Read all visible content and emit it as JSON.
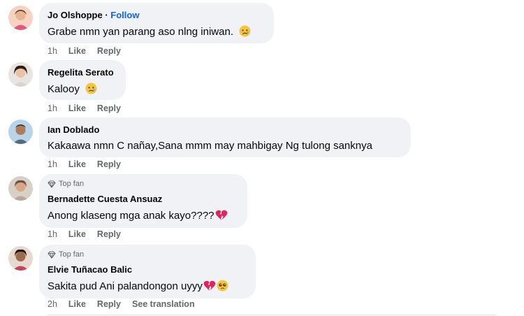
{
  "comments": [
    {
      "author": "Jo Olshoppe",
      "separator": " · ",
      "follow_label": "Follow",
      "text": "Grabe nmn yan parang aso nlng iniwan.",
      "emoji": "sad-face-icon",
      "time": "1h",
      "like_label": "Like",
      "reply_label": "Reply"
    },
    {
      "author": "Regelita Serato",
      "text": "Kalooy",
      "emoji": "sad-face-icon",
      "time": "1h",
      "like_label": "Like",
      "reply_label": "Reply"
    },
    {
      "author": "Ian Doblado",
      "text": "Kakaawa nmn C nañay,Sana mmm may mahbigay Ng tulong sanknya",
      "time": "1h",
      "like_label": "Like",
      "reply_label": "Reply"
    },
    {
      "badge": "Top fan",
      "author": "Bernadette Cuesta Ansuaz",
      "text": "Anong klaseng mga anak kayo????",
      "emoji": "broken-heart-icon",
      "time": "1h",
      "like_label": "Like",
      "reply_label": "Reply"
    },
    {
      "badge": "Top fan",
      "author": "Elvie Tuñacao Balic",
      "text": "Sakita pud Ani palandongon uyyy",
      "emoji": "broken-heart-icon, pleading-face-icon",
      "time": "2h",
      "like_label": "Like",
      "reply_label": "Reply",
      "translation_label": "See translation"
    }
  ],
  "colors": {
    "bubble": "#f0f2f5",
    "secondary_text": "#65676b",
    "follow": "#0866ff",
    "broken_heart": "#e0245e",
    "emoji_face": "#f7c53b"
  }
}
